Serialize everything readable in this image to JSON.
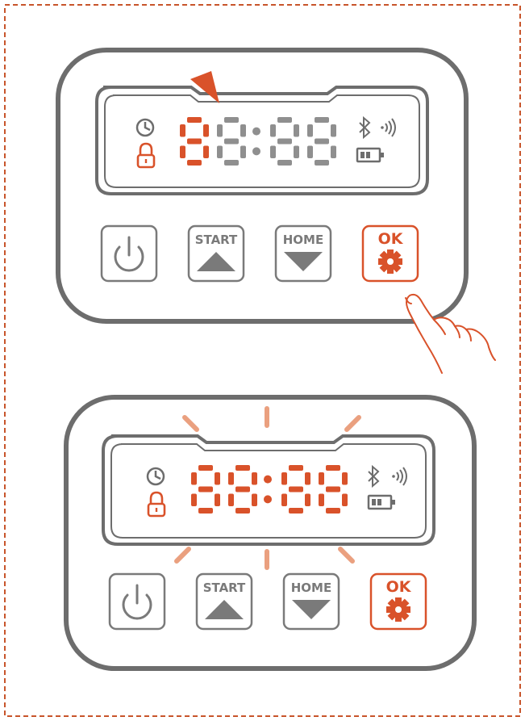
{
  "colors": {
    "frame": "#c8552b",
    "accent": "#d9522a",
    "device": "#6d6d6d",
    "segment_off": "#8f8f8f",
    "button_gray": "#7a7a7a",
    "glow": "#eaa07f"
  },
  "panels": [
    {
      "display": {
        "digits_left": "88",
        "digits_right": "88",
        "lit_digit_count": 1,
        "icons": [
          "clock-icon",
          "lock-icon",
          "bluetooth-icon",
          "signal-icon",
          "battery-icon"
        ]
      },
      "buttons": [
        {
          "name": "power-button",
          "icon": "power-icon",
          "label": "",
          "active": false
        },
        {
          "name": "start-button",
          "icon": "triangle-up-icon",
          "label": "START",
          "active": false
        },
        {
          "name": "home-button",
          "icon": "triangle-down-icon",
          "label": "HOME",
          "active": false
        },
        {
          "name": "ok-button",
          "icon": "gear-icon",
          "label": "OK",
          "active": true
        }
      ],
      "pointer": "arrow-pointer-icon",
      "hand": "hand-pointer-icon"
    },
    {
      "display": {
        "digits_left": "88",
        "digits_right": "88",
        "lit_digit_count": 4,
        "icons": [
          "clock-icon",
          "lock-icon",
          "bluetooth-icon",
          "signal-icon",
          "battery-icon"
        ]
      },
      "buttons": [
        {
          "name": "power-button",
          "icon": "power-icon",
          "label": "",
          "active": false
        },
        {
          "name": "start-button",
          "icon": "triangle-up-icon",
          "label": "START",
          "active": false
        },
        {
          "name": "home-button",
          "icon": "triangle-down-icon",
          "label": "HOME",
          "active": false
        },
        {
          "name": "ok-button",
          "icon": "gear-icon",
          "label": "OK",
          "active": true
        }
      ],
      "blinking": true
    }
  ]
}
